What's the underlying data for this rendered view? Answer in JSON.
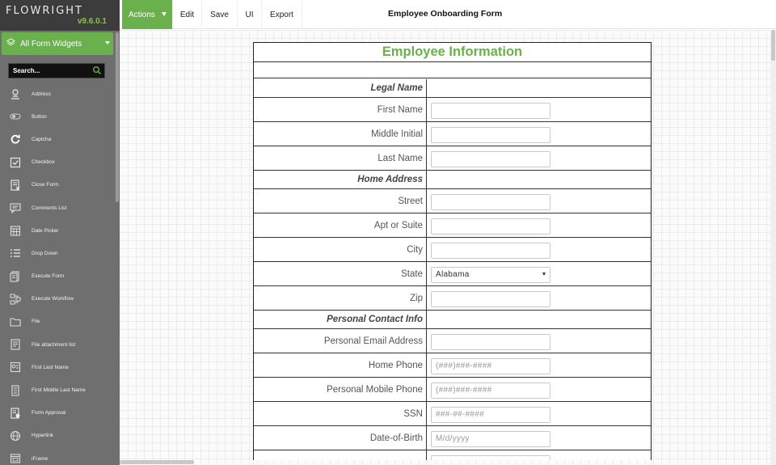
{
  "sidebar": {
    "brand": "FLOWRIGHT",
    "version": "v9.6.0.1",
    "widgets_label": "All Form Widgets",
    "search_placeholder": "Search...",
    "items": [
      {
        "label": "Address",
        "icon": "person-pin-icon"
      },
      {
        "label": "Button",
        "icon": "toggle-icon"
      },
      {
        "label": "Captcha",
        "icon": "refresh-icon"
      },
      {
        "label": "Checkbox",
        "icon": "checkbox-icon"
      },
      {
        "label": "Close Form",
        "icon": "close-form-icon"
      },
      {
        "label": "Comments List",
        "icon": "comments-icon"
      },
      {
        "label": "Date Picker",
        "icon": "calendar-icon"
      },
      {
        "label": "Drop Down",
        "icon": "list-icon"
      },
      {
        "label": "Execute Form",
        "icon": "execute-form-icon"
      },
      {
        "label": "Execute Workflow",
        "icon": "workflow-icon"
      },
      {
        "label": "File",
        "icon": "folder-icon"
      },
      {
        "label": "File attachment list",
        "icon": "attachment-list-icon"
      },
      {
        "label": "First Last Name",
        "icon": "name-card-icon"
      },
      {
        "label": "First Middle Last Name",
        "icon": "name-card-long-icon"
      },
      {
        "label": "Form Approval",
        "icon": "approval-icon"
      },
      {
        "label": "Hyperlink",
        "icon": "globe-icon"
      },
      {
        "label": "iFrame",
        "icon": "iframe-icon"
      }
    ]
  },
  "toolbar": {
    "actions_label": "Actions",
    "edit_label": "Edit",
    "save_label": "Save",
    "ui_label": "UI",
    "export_label": "Export",
    "form_title": "Employee Onboarding Form"
  },
  "form": {
    "heading": "Employee Information",
    "rows": [
      {
        "type": "section",
        "label": "Legal Name"
      },
      {
        "type": "field",
        "label": "First Name",
        "value": ""
      },
      {
        "type": "field",
        "label": "Middle Initial",
        "value": ""
      },
      {
        "type": "field",
        "label": "Last Name",
        "value": ""
      },
      {
        "type": "section",
        "label": "Home Address"
      },
      {
        "type": "field",
        "label": "Street",
        "value": ""
      },
      {
        "type": "field",
        "label": "Apt or Suite",
        "value": ""
      },
      {
        "type": "field",
        "label": "City",
        "value": ""
      },
      {
        "type": "select",
        "label": "State",
        "value": "Alabama"
      },
      {
        "type": "field",
        "label": "Zip",
        "value": ""
      },
      {
        "type": "section",
        "label": "Personal Contact Info"
      },
      {
        "type": "field",
        "label": "Personal Email Address",
        "value": ""
      },
      {
        "type": "field",
        "label": "Home Phone",
        "placeholder": "(###)###-####"
      },
      {
        "type": "field",
        "label": "Personal Mobile Phone",
        "placeholder": "(###)###-####"
      },
      {
        "type": "field",
        "label": "SSN",
        "placeholder": "###-##-####"
      },
      {
        "type": "field",
        "label": "Date-of-Birth",
        "placeholder": "M/d/yyyy"
      },
      {
        "type": "field",
        "label": "",
        "value": ""
      }
    ]
  },
  "colors": {
    "accent": "#6ab04c",
    "sidebar_bg": "#6f6f6f",
    "logo_bg": "#3c3c3c"
  }
}
